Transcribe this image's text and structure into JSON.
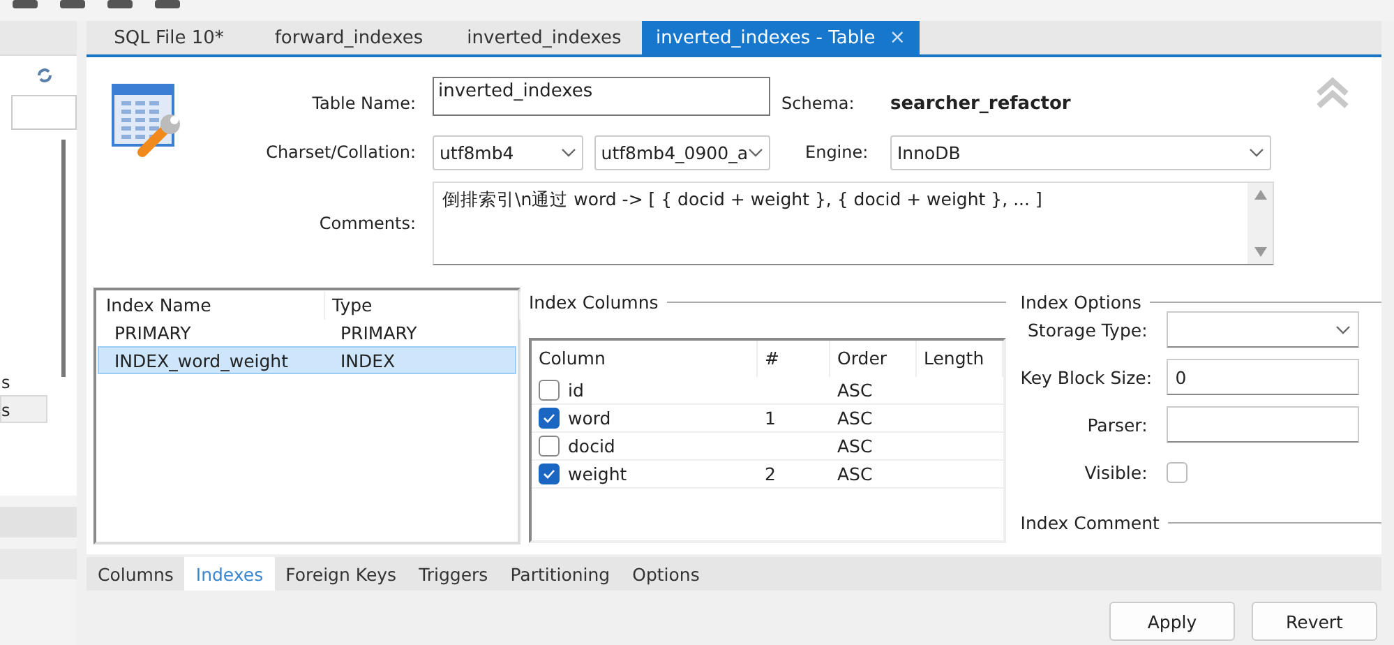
{
  "sidebar": {
    "items": [
      {
        "label": "s",
        "selected": false
      },
      {
        "label": "s",
        "selected": true
      }
    ]
  },
  "tabs": [
    {
      "label": "SQL File 10*",
      "selected": false
    },
    {
      "label": "forward_indexes",
      "selected": false
    },
    {
      "label": "inverted_indexes",
      "selected": false
    },
    {
      "label": "inverted_indexes - Table",
      "selected": true,
      "close": "×"
    }
  ],
  "form": {
    "table_name_label": "Table Name:",
    "table_name": "inverted_indexes",
    "schema_label": "Schema:",
    "schema": "searcher_refactor",
    "charset_label": "Charset/Collation:",
    "charset": "utf8mb4",
    "collation": "utf8mb4_0900_a",
    "engine_label": "Engine:",
    "engine": "InnoDB",
    "comments_label": "Comments:",
    "comments": "倒排索引\\n通过 word -> [ { docid + weight }, { docid + weight }, ... ]"
  },
  "indexes": {
    "columns": [
      "Index Name",
      "Type"
    ],
    "rows": [
      {
        "name": "PRIMARY",
        "type": "PRIMARY",
        "selected": false
      },
      {
        "name": "INDEX_word_weight",
        "type": "INDEX",
        "selected": true
      }
    ]
  },
  "index_columns": {
    "title": "Index Columns",
    "columns": [
      "Column",
      "#",
      "Order",
      "Length"
    ],
    "rows": [
      {
        "column": "id",
        "checked": false,
        "number": "",
        "order": "ASC"
      },
      {
        "column": "word",
        "checked": true,
        "number": "1",
        "order": "ASC"
      },
      {
        "column": "docid",
        "checked": false,
        "number": "",
        "order": "ASC"
      },
      {
        "column": "weight",
        "checked": true,
        "number": "2",
        "order": "ASC"
      }
    ]
  },
  "index_options": {
    "title": "Index Options",
    "storage_type_label": "Storage Type:",
    "key_block_size_label": "Key Block Size:",
    "key_block_size": "0",
    "parser_label": "Parser:",
    "visible_label": "Visible:",
    "visible": false,
    "index_comment_title": "Index Comment"
  },
  "bottom_tabs": [
    {
      "label": "Columns",
      "selected": false
    },
    {
      "label": "Indexes",
      "selected": true
    },
    {
      "label": "Foreign Keys",
      "selected": false
    },
    {
      "label": "Triggers",
      "selected": false
    },
    {
      "label": "Partitioning",
      "selected": false
    },
    {
      "label": "Options",
      "selected": false
    }
  ],
  "buttons": [
    "Apply",
    "Revert"
  ]
}
